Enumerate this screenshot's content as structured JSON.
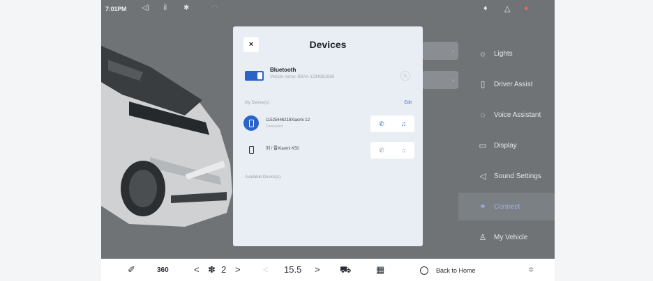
{
  "status_bar": {
    "time": "7:01PM",
    "left_icons": [
      "volume-icon",
      "signal-icon",
      "bluetooth-icon",
      "wifi-icon"
    ],
    "right_icons": [
      "mic-icon",
      "notification-icon",
      "profile-icon"
    ]
  },
  "dialog": {
    "title": "Devices",
    "close_glyph": "×",
    "bluetooth": {
      "label": "Bluetooth",
      "vehicle_name": "Vehicle name: BBAA-1234BB1886",
      "enabled": true
    },
    "my_devices_label": "My Device(s)",
    "edit_label": "Edit",
    "devices": [
      {
        "name": "11525446218Xiaomi 12",
        "status": "Connected",
        "connected": true,
        "call_glyph": "✆",
        "music_glyph": "♫"
      },
      {
        "name": "刘 / 雷Xiaomi K50",
        "status": "",
        "connected": false,
        "call_glyph": "✆",
        "music_glyph": "♫"
      }
    ],
    "available_label": "Available Device(s)"
  },
  "menu": {
    "items": [
      {
        "label": "Lights",
        "icon": "☼"
      },
      {
        "label": "Driver Assist",
        "icon": "▯"
      },
      {
        "label": "Voice Assistant",
        "icon": "◌"
      },
      {
        "label": "Display",
        "icon": "▭"
      },
      {
        "label": "Sound Settings",
        "icon": "◁"
      },
      {
        "label": "Connect",
        "icon": "⚭",
        "active": true
      },
      {
        "label": "My Vehicle",
        "icon": "♙"
      }
    ]
  },
  "bottom_bar": {
    "fan_value": "2",
    "fan_prev": "<",
    "fan_next": ">",
    "temp_value": "15.5",
    "temp_prev": "<",
    "temp_next": ">",
    "view_360": "360",
    "home_label": "Back to Home"
  },
  "colors": {
    "accent": "#2a64c8",
    "screen_bg": "#6f7376",
    "dialog_bg": "#e9eef4"
  }
}
